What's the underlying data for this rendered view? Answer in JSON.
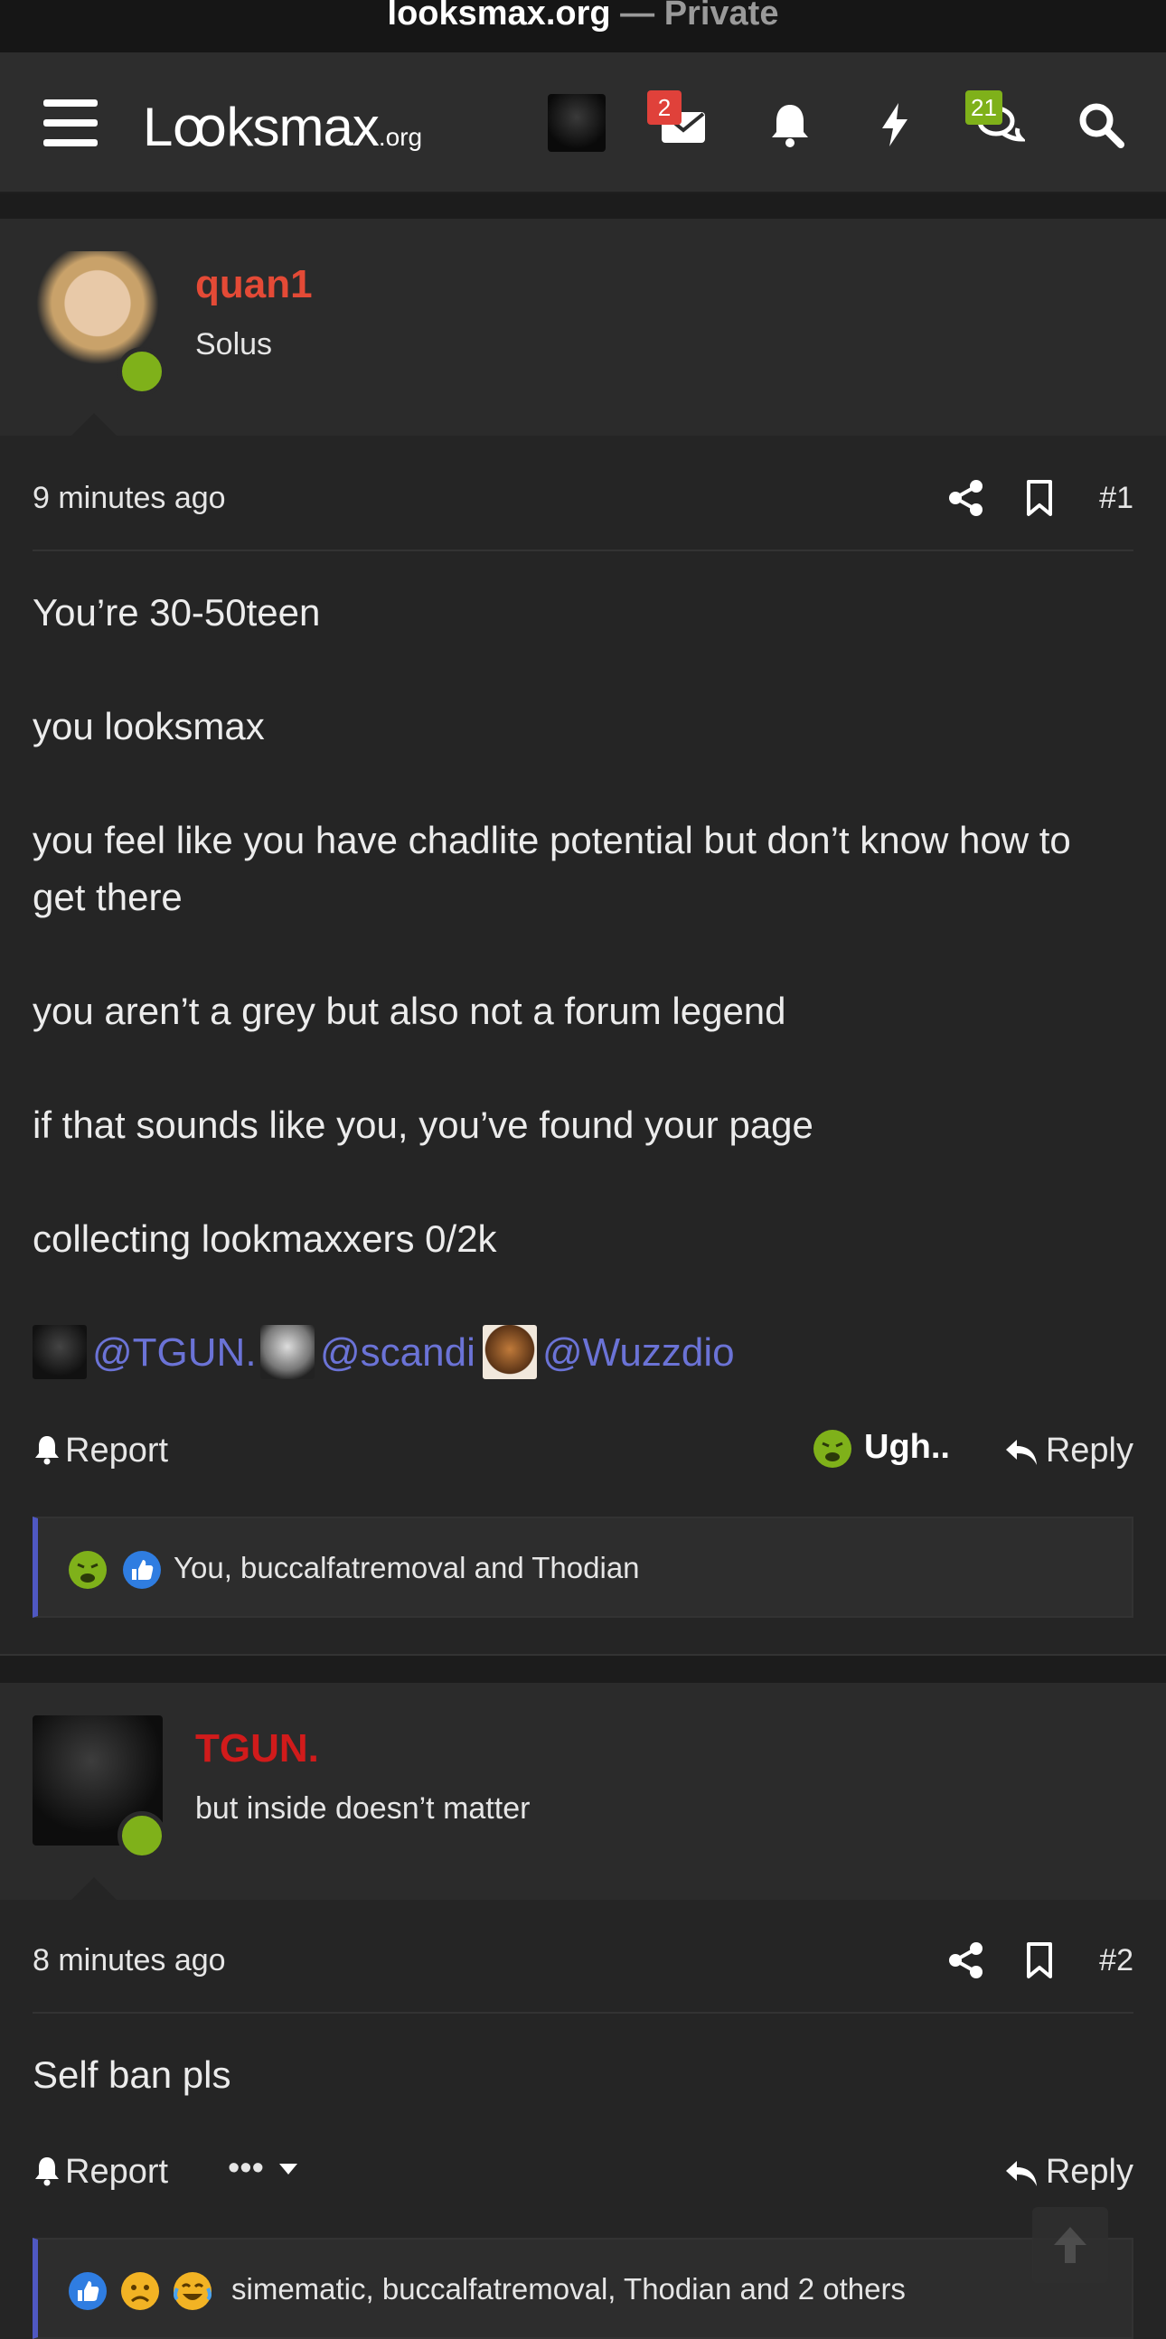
{
  "browser": {
    "domain": "looksmax.org",
    "suffix": "— Private"
  },
  "nav": {
    "logo_main": "Lꝏksmax",
    "logo_tld": ".org",
    "inbox_badge": "2",
    "alerts_badge": "21",
    "colors": {
      "inbox_badge": "#e0413a",
      "alerts_badge": "#7fb11a"
    }
  },
  "posts": [
    {
      "username": "quan1",
      "username_color": "#e44a36",
      "user_title": "Solus",
      "time": "9 minutes ago",
      "post_number": "#1",
      "paragraphs": [
        "You’re 30-50teen",
        "you looksmax",
        "you feel like you have chadlite potential but don’t know how to get there",
        "you aren’t a grey but also not a forum legend",
        "if that sounds like you, you’ve found your page",
        "collecting lookmaxxers 0/2k"
      ],
      "mentions": [
        "@TGUN.",
        "@scandi",
        "@Wuzzdio"
      ],
      "report_label": "Report",
      "reaction_label": "Ugh..",
      "reply_label": "Reply",
      "reactions_text": "You, buccalfatremoval and Thodian"
    },
    {
      "username": "TGUN.",
      "username_color": "#d11b1b",
      "user_title": "but inside doesn’t matter",
      "time": "8 minutes ago",
      "post_number": "#2",
      "paragraphs": [
        "Self ban pls"
      ],
      "report_label": "Report",
      "more_label": "•••",
      "reply_label": "Reply",
      "reactions_text": "simematic, buccalfatremoval, Thodian and 2 others"
    }
  ]
}
